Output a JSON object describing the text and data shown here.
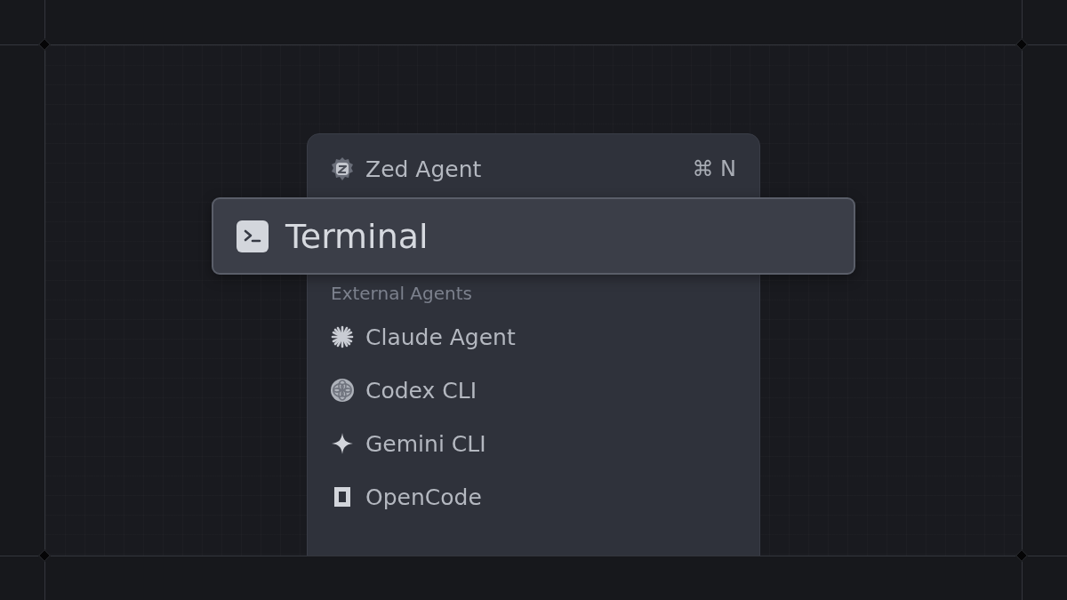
{
  "menu": {
    "items": [
      {
        "label": "Zed Agent",
        "shortcut": "⌘ N",
        "selected": false
      },
      {
        "label": "Terminal",
        "selected": true
      }
    ],
    "external_agents": {
      "heading": "External Agents",
      "items": [
        {
          "label": "Claude Agent",
          "selected": false
        },
        {
          "label": "Codex CLI",
          "selected": false
        },
        {
          "label": "Gemini CLI",
          "selected": false
        },
        {
          "label": "OpenCode",
          "selected": false
        }
      ]
    }
  }
}
